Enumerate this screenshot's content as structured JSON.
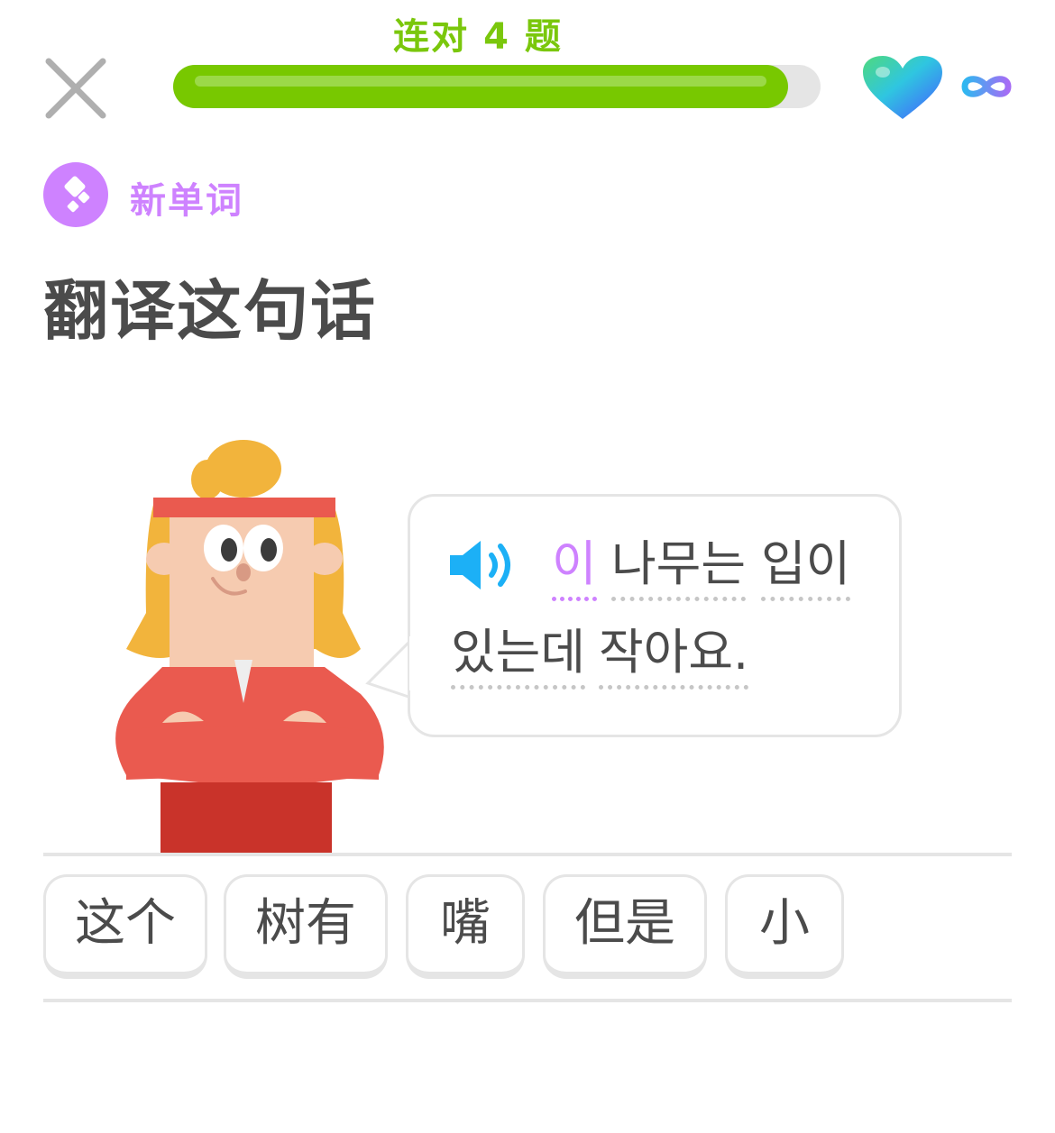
{
  "header": {
    "streak_text": "连对 4 题",
    "progress": 0.95,
    "lives": "∞",
    "close_icon": "close-icon",
    "heart_icon": "heart-icon",
    "infinity_icon": "infinity-icon"
  },
  "lesson": {
    "badge_label": "新单词",
    "title": "翻译这句话"
  },
  "prompt": {
    "words": [
      "이",
      "나무는",
      "입이",
      "있는데",
      "작아요."
    ],
    "highlighted_word_index": 0
  },
  "word_bank": {
    "chips": [
      "这个",
      "树有",
      "嘴",
      "但是",
      "小"
    ]
  },
  "colors": {
    "green": "#78c800",
    "purple": "#ce82ff",
    "text": "#4b4b4b",
    "border": "#e5e5e5"
  }
}
